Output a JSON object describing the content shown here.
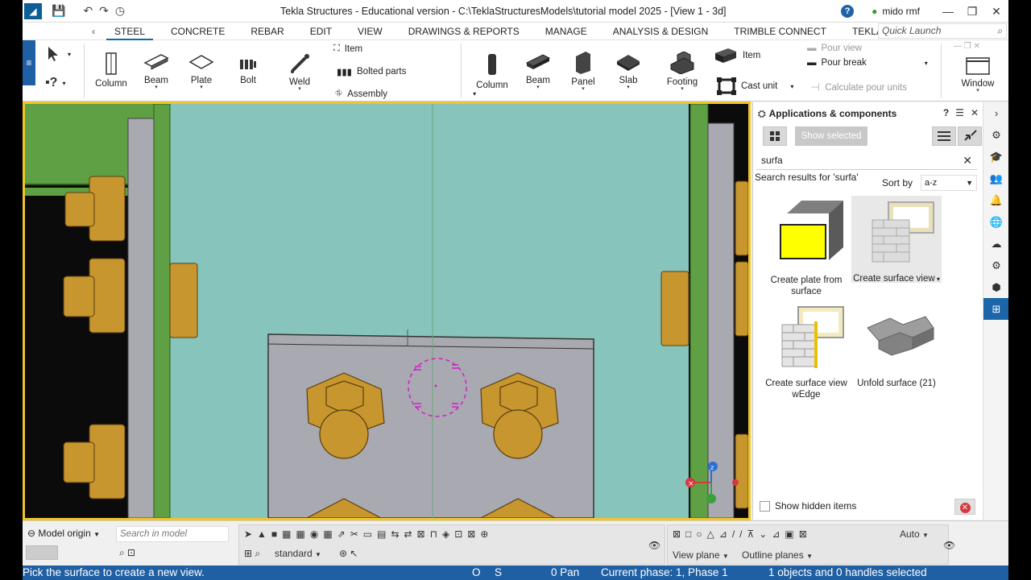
{
  "window": {
    "title": "Tekla Structures - Educational version - C:\\TeklaStructuresModels\\tutorial model 2025  - [View 1 - 3d]",
    "user": "mido rmf",
    "help": "?",
    "minimize": "—",
    "restore": "❐",
    "close": "✕"
  },
  "tabs": [
    {
      "label": "STEEL",
      "active": true
    },
    {
      "label": "CONCRETE"
    },
    {
      "label": "REBAR"
    },
    {
      "label": "EDIT"
    },
    {
      "label": "VIEW"
    },
    {
      "label": "DRAWINGS & REPORTS"
    },
    {
      "label": "MANAGE"
    },
    {
      "label": "ANALYSIS & DESIGN"
    },
    {
      "label": "TRIMBLE CONNECT"
    },
    {
      "label": "TEKLA POWERFAB"
    }
  ],
  "quick_launch": {
    "placeholder": "Quick Launch"
  },
  "ribbon": {
    "steel": {
      "column": "Column",
      "beam": "Beam",
      "plate": "Plate",
      "bolt": "Bolt",
      "weld": "Weld",
      "item": "Item",
      "bolted_parts": "Bolted parts",
      "assembly": "Assembly"
    },
    "concrete": {
      "column": "Column",
      "beam": "Beam",
      "panel": "Panel",
      "slab": "Slab",
      "footing": "Footing",
      "item": "Item",
      "cast_unit": "Cast unit",
      "pour_view": "Pour view",
      "pour_break": "Pour break",
      "calc_pour_units": "Calculate pour units"
    },
    "window": "Window"
  },
  "panel": {
    "title": "Applications & components",
    "show_selected": "Show selected",
    "search_value": "surfa",
    "results_label": "Search results for 'surfa'",
    "sort_label": "Sort by",
    "sort_value": "a-z",
    "components": [
      {
        "label": "Create plate from surface"
      },
      {
        "label": "Create surface view",
        "selected": true
      },
      {
        "label": "Create surface view wEdge"
      },
      {
        "label": "Unfold surface (21)"
      }
    ],
    "show_hidden": "Show hidden items"
  },
  "bottom": {
    "model_origin": "Model origin",
    "search_model_placeholder": "Search in model",
    "standard": "standard",
    "auto": "Auto",
    "view_plane": "View plane",
    "outline_planes": "Outline planes"
  },
  "status": {
    "prompt": "Pick the surface to create a new view.",
    "o": "O",
    "s": "S",
    "pan": "0 Pan",
    "phase": "Current phase: 1, Phase 1",
    "selection": "1 objects and 0 handles selected"
  },
  "colors": {
    "accent_blue": "#1f5fa3",
    "viewport_bg": "#87c4bc",
    "viewport_border": "#f2c42a",
    "bolt_color": "#c8962e",
    "plate_color": "#a9a9b1",
    "green_member": "#5fa044"
  }
}
